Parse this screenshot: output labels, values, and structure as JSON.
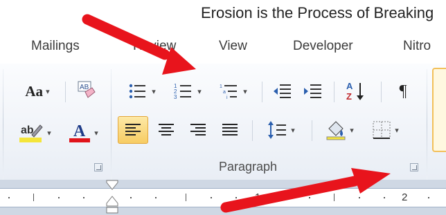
{
  "window": {
    "title": "Erosion is the Process of Breaking"
  },
  "tabs": [
    {
      "label": "Mailings"
    },
    {
      "label": "Review"
    },
    {
      "label": "View"
    },
    {
      "label": "Developer"
    },
    {
      "label": "Nitro"
    }
  ],
  "font_group": {
    "change_case_label": "Aa",
    "dropdown_glyph": "▾",
    "icons": [
      "change-case-icon",
      "clear-formatting-icon",
      "text-highlight-color-icon",
      "font-color-icon"
    ],
    "highlight_color": "#f4e53a",
    "font_color": "#e0141b"
  },
  "paragraph_group": {
    "label": "Paragraph",
    "pilcrow": "¶",
    "sort_label_top": "A",
    "sort_label_bottom": "Z",
    "icons": [
      "bullets-icon",
      "numbering-icon",
      "multilevel-list-icon",
      "decrease-indent-icon",
      "increase-indent-icon",
      "sort-icon",
      "show-hide-icon",
      "align-left-icon",
      "center-icon",
      "align-right-icon",
      "justify-icon",
      "line-spacing-icon",
      "shading-icon",
      "borders-icon"
    ]
  },
  "ruler": {
    "numbers": [
      "1",
      "2"
    ]
  },
  "annotations": {
    "arrow_color": "#e8141c"
  }
}
